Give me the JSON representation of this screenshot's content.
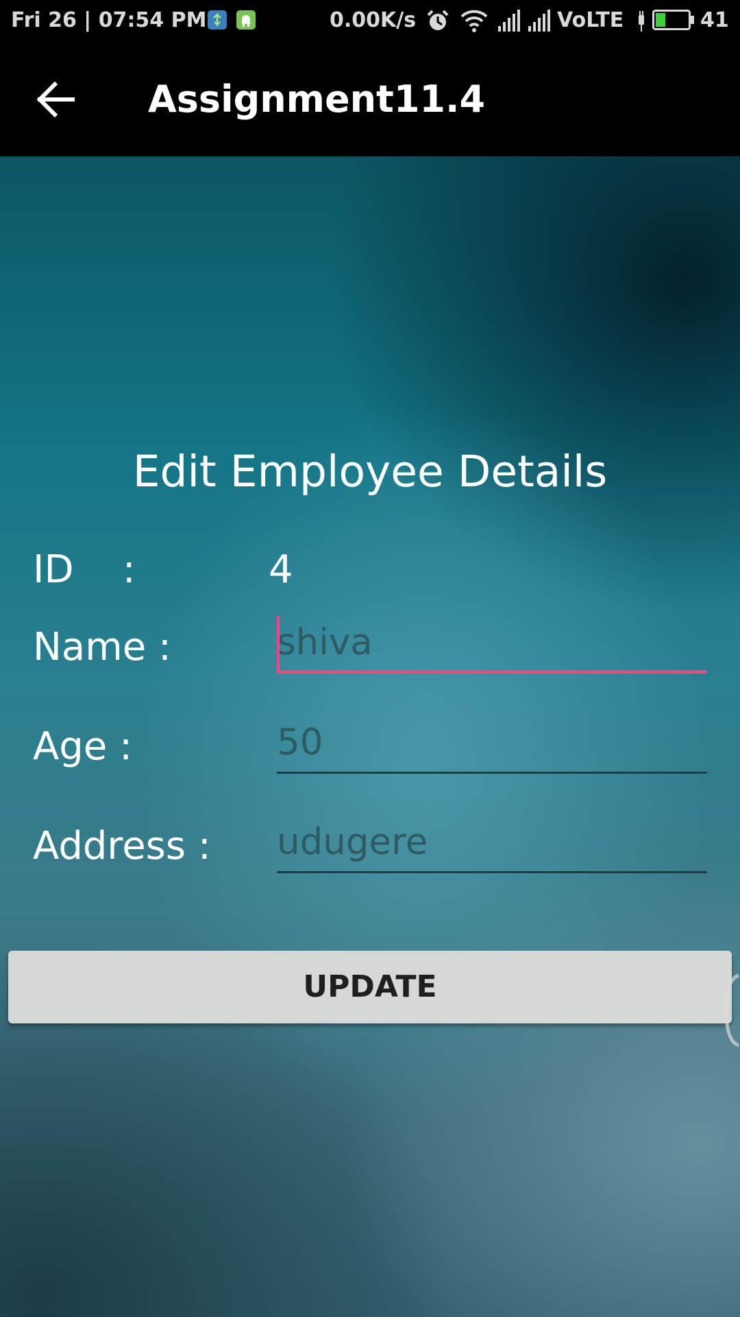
{
  "status_bar": {
    "datetime": "Fri 26 | 07:54 PM",
    "net_speed": "0.00K/s",
    "network_type": "VoLTE",
    "battery_level": "41",
    "battery_fraction": 0.3,
    "icons": [
      "usb-notification-icon",
      "android-notification-icon",
      "alarm-icon",
      "wifi-icon",
      "signal-icon",
      "signal-icon",
      "charging-icon",
      "battery-icon"
    ],
    "colors": {
      "battery_fill": "#3dd13d",
      "notif_blue": "#3a7fbf",
      "notif_green": "#78c257"
    }
  },
  "app_bar": {
    "title": "Assignment11.4",
    "back_icon": "arrow-back-icon"
  },
  "form": {
    "title": "Edit Employee Details",
    "id_label": "ID    :",
    "id_value": "4",
    "name_label": "Name :",
    "name_value": "shiva",
    "age_label": "Age :",
    "age_value": "50",
    "address_label": "Address :",
    "address_value": "udugere",
    "update_label": "UPDATE"
  },
  "colors": {
    "accent": "#ff4081",
    "field_text": "#2d5a63",
    "button_bg": "#d6d7d7"
  }
}
